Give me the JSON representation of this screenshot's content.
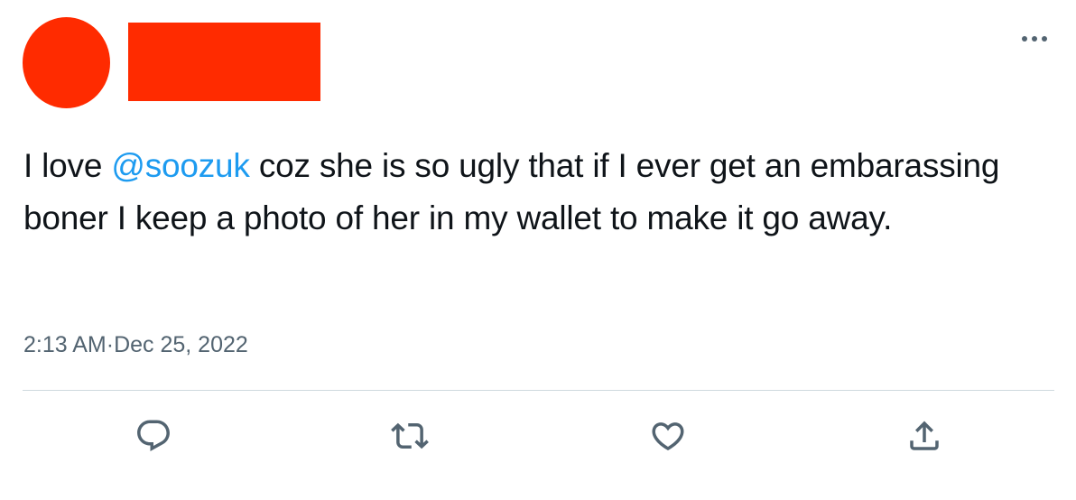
{
  "tweet": {
    "text_prefix": "I love ",
    "mention": "@soozuk",
    "text_suffix": " coz she is so ugly that if I ever get an embarassing boner I keep a photo of her in my wallet to make it go away.",
    "time": "2:13 AM",
    "separator": " · ",
    "date": "Dec 25, 2022"
  },
  "icons": {
    "more": "more-horizontal-icon",
    "reply": "reply-icon",
    "retweet": "retweet-icon",
    "like": "heart-icon",
    "share": "share-icon"
  },
  "colors": {
    "redaction": "#ff2b00",
    "mention": "#1d9bf0",
    "secondary_text": "#536471",
    "primary_text": "#0f1419",
    "divider": "#cfd9de"
  }
}
